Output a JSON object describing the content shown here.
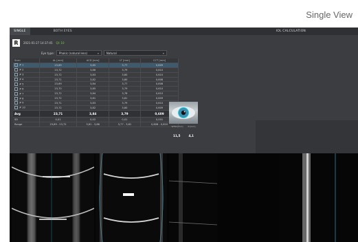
{
  "caption": "Single View",
  "tabs": [
    {
      "label": "SINGLE",
      "active": true
    },
    {
      "label": "BOTH EYES",
      "active": false
    },
    {
      "label": "",
      "active": false
    },
    {
      "label": "",
      "active": false
    }
  ],
  "tab_right": "IOL CALCULATION",
  "patient": {
    "eye": "R",
    "timestamp": "2021-01-27 14:37:45",
    "quality_label": "QI: 10"
  },
  "eye_type": {
    "label": "Eye type:",
    "value": "Phakic (natural lens)",
    "secondary_value": "Natural"
  },
  "table": {
    "headers": [
      "Scan",
      "AL [mm]",
      "ACD [mm]",
      "LT [mm]",
      "CCT [mm]"
    ],
    "rows": [
      [
        "# 1",
        "23,69",
        "3,85",
        "3,77",
        "0,609"
      ],
      [
        "# 2",
        "23,72",
        "3,86",
        "3,79",
        "0,610"
      ],
      [
        "# 3",
        "23,72",
        "3,83",
        "3,80",
        "0,610"
      ],
      [
        "# 4",
        "23,71",
        "3,82",
        "3,80",
        "0,608"
      ],
      [
        "# 5",
        "23,69",
        "3,84",
        "3,77",
        "0,608"
      ],
      [
        "# 6",
        "23,70",
        "3,85",
        "3,79",
        "0,610"
      ],
      [
        "# 7",
        "23,72",
        "3,84",
        "3,78",
        "0,610"
      ],
      [
        "# 8",
        "23,72",
        "3,81",
        "3,81",
        "0,609"
      ],
      [
        "# 9",
        "23,71",
        "3,83",
        "3,79",
        "0,610"
      ],
      [
        "# 10",
        "23,72",
        "3,82",
        "3,80",
        "0,609"
      ]
    ],
    "avg": {
      "label": "Avg",
      "values": [
        "23,71",
        "3,84",
        "3,79",
        "0,609"
      ]
    },
    "sd": {
      "label": "SD",
      "values": [
        "0,01",
        "0,02",
        "0,01",
        "0,001"
      ]
    },
    "range": {
      "label": "Range",
      "values": [
        "23,69 - 23,72",
        "3,81 - 3,86",
        "3,77 - 3,81",
        "0,608 - 0,610"
      ]
    }
  },
  "wtw": {
    "headers": [
      "WTW [mm]",
      "P [mm]"
    ],
    "values": [
      "11,5",
      "4,1"
    ]
  },
  "scan_labels": {
    "top_left": "S",
    "bottom_left": "I",
    "top_right": "1 / 10"
  },
  "colors": {
    "app_bg": "#3b3d40",
    "tab_bar": "#2e3033",
    "quality_green": "#7bd145",
    "selected_row": "#3f5a6c",
    "scan_bg": "#050505",
    "scan_line_cyan": "#47b3d9"
  }
}
